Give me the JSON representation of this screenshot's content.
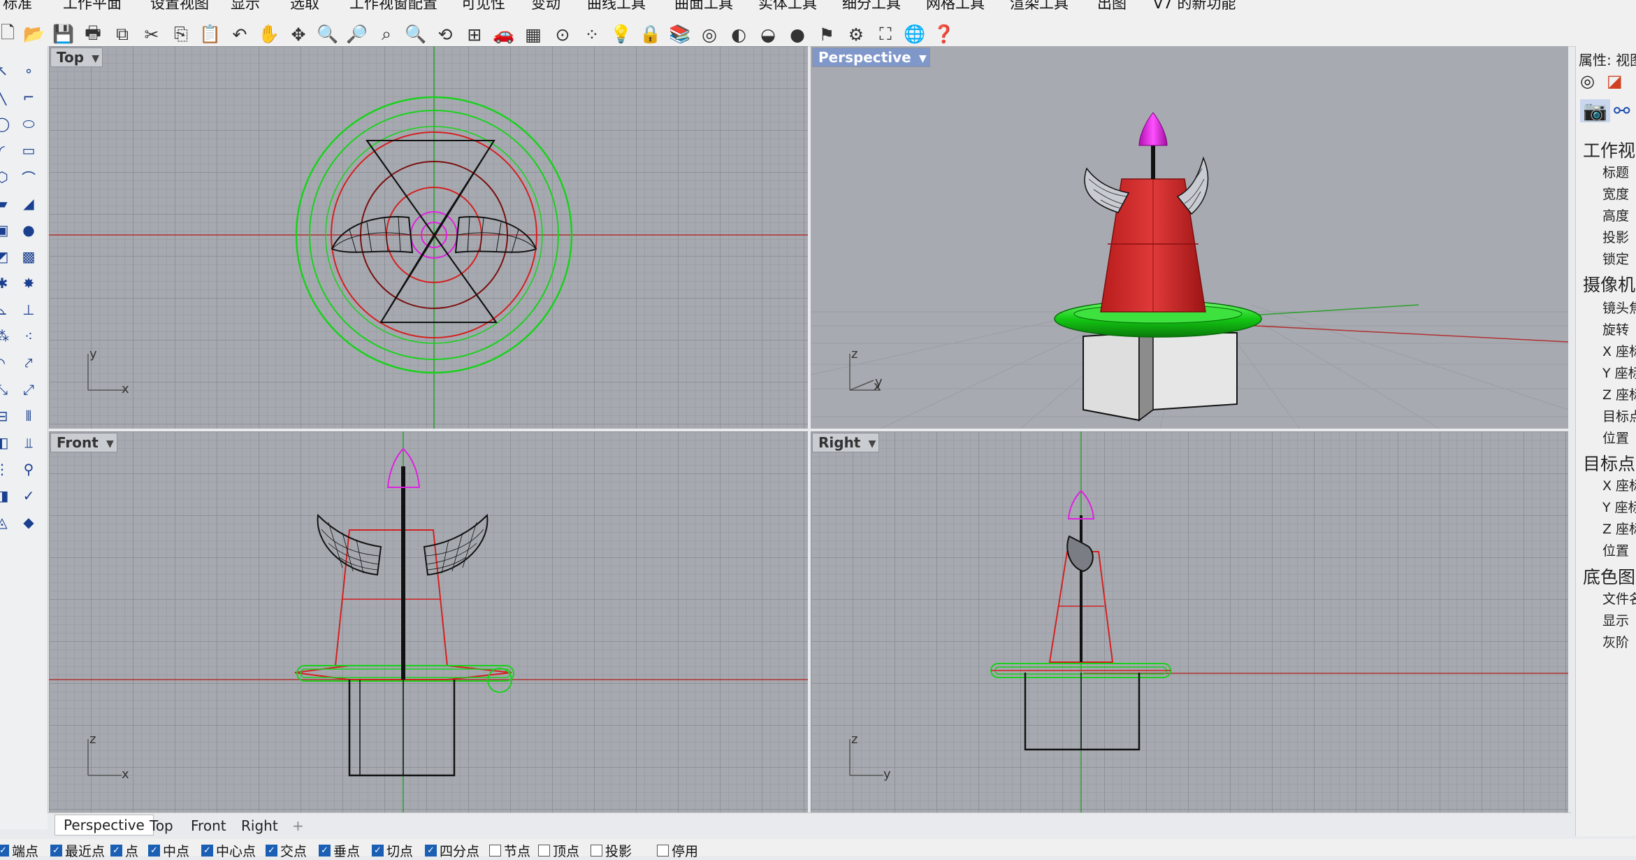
{
  "menu": [
    "标准",
    "工作平面",
    "设置视图",
    "显示",
    "选取",
    "工作视窗配置",
    "可见性",
    "变动",
    "曲线工具",
    "曲面工具",
    "实体工具",
    "细分工具",
    "网格工具",
    "渲染工具",
    "出图",
    "V7 的新功能"
  ],
  "toolbar": {
    "icons": [
      "new-icon",
      "open-icon",
      "save-icon",
      "print-icon",
      "export-icon",
      "cut-icon",
      "copy-icon",
      "paste-icon",
      "undo-icon",
      "pan-hand-icon",
      "rotate-view-icon",
      "zoom-icon",
      "zoom-window-icon",
      "zoom-extents-icon",
      "zoom-selected-icon",
      "undo-view-icon",
      "four-viewports-icon",
      "car-icon",
      "grid-icon",
      "snap-icon",
      "points-icon",
      "light-icon",
      "lock-icon",
      "layer-icon",
      "color-wheel-icon",
      "render-sphere-icon",
      "display-mode-icon",
      "render-icon",
      "lamp-icon",
      "settings-icon",
      "options-icon",
      "globe-icon",
      "help-icon"
    ]
  },
  "viewports": {
    "top": {
      "title": "Top",
      "axis_v": "y",
      "axis_h": "x"
    },
    "perspective": {
      "title": "Perspective",
      "axis_v": "z",
      "axis_h": "x",
      "axis_h2": "y"
    },
    "front": {
      "title": "Front",
      "axis_v": "z",
      "axis_h": "x"
    },
    "right": {
      "title": "Right",
      "axis_v": "z",
      "axis_h": "y"
    }
  },
  "tabs": [
    "Perspective",
    "Top",
    "Front",
    "Right"
  ],
  "tabs_add": "+",
  "osnap": [
    {
      "label": "端点",
      "checked": true
    },
    {
      "label": "最近点",
      "checked": true
    },
    {
      "label": "点",
      "checked": true
    },
    {
      "label": "中点",
      "checked": true
    },
    {
      "label": "中心点",
      "checked": true
    },
    {
      "label": "交点",
      "checked": true
    },
    {
      "label": "垂点",
      "checked": true
    },
    {
      "label": "切点",
      "checked": true
    },
    {
      "label": "四分点",
      "checked": true
    },
    {
      "label": "节点",
      "checked": false
    },
    {
      "label": "顶点",
      "checked": false
    },
    {
      "label": "投影",
      "checked": false
    },
    {
      "label": "停用",
      "checked": false
    }
  ],
  "properties": {
    "header": "属性: 视图",
    "sections": [
      {
        "title": "工作视窗",
        "fields": [
          "标题",
          "宽度",
          "高度",
          "投影",
          "锁定"
        ]
      },
      {
        "title": "摄像机",
        "fields": [
          "镜头焦距",
          "旋转",
          "X 座标",
          "Y 座标",
          "Z 座标",
          "目标点",
          "位置"
        ]
      },
      {
        "title": "目标点",
        "fields": [
          "X 座标",
          "Y 座标",
          "Z 座标",
          "位置"
        ]
      },
      {
        "title": "底色图案",
        "fields": [
          "文件名",
          "显示",
          "灰阶"
        ]
      }
    ]
  },
  "colors": {
    "accent": "#7f97c9",
    "grid": "#a6aab0",
    "red": "#d42020",
    "green": "#19d11c",
    "magenta": "#e020e0"
  }
}
